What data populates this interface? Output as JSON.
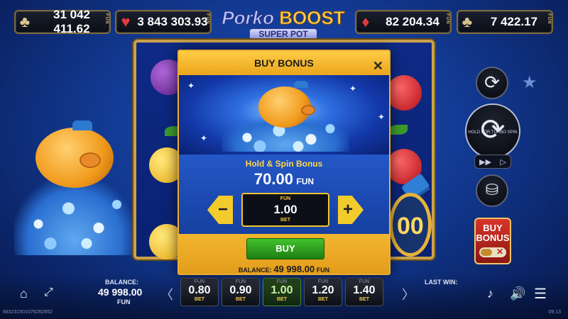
{
  "jackpots": [
    {
      "suit": "club-icon",
      "glyph": "♣",
      "value": "31 042 411.62",
      "unit": "FUN"
    },
    {
      "suit": "heart-icon",
      "glyph": "♥",
      "value": "3 843 303.93",
      "unit": "FUN"
    },
    {
      "suit": "diamond-icon",
      "glyph": "♦",
      "value": "82 204.34",
      "unit": "FUN"
    },
    {
      "suit": "club-icon",
      "glyph": "♣",
      "value": "7 422.17",
      "unit": "FUN"
    }
  ],
  "logo": {
    "part1": "Porko",
    "part2": "BOOST",
    "subtitle": "SUPER POT"
  },
  "modal": {
    "title": "BUY BONUS",
    "close_glyph": "✕",
    "bonus_name": "Hold & Spin Bonus",
    "price_value": "70.00",
    "price_currency": "FUN",
    "minus_glyph": "−",
    "plus_glyph": "+",
    "bet_top": "FUN",
    "bet_value": "1.00",
    "bet_bottom": "BET",
    "buy_label": "BUY",
    "balance_label": "BALANCE:",
    "balance_value": "49 998.00",
    "balance_currency": "FUN"
  },
  "reels": {
    "big_coin_text": "00"
  },
  "side": {
    "autoplay_glyph": "⟳",
    "star_glyph": "★",
    "spin_hold_text": "HOLD FOR TURBO SPIN",
    "spin_glyph": "⟳",
    "turbo_left": "▶▶",
    "turbo_right": "▷",
    "coins_glyph": "⛁",
    "buy_bonus_line1": "BUY",
    "buy_bonus_line2": "BONUS",
    "buy_bonus_toggle_x": "✕"
  },
  "bottom": {
    "home_glyph": "⌂",
    "fullscreen_glyph": "⤢",
    "balance_label": "BALANCE:",
    "balance_value": "49 998.00",
    "balance_unit": "FUN",
    "arrow_left": "〈",
    "arrow_right": "〉",
    "bets": [
      {
        "top": "FUN",
        "value": "0.80",
        "bottom": "BET",
        "selected": false
      },
      {
        "top": "FUN",
        "value": "0.90",
        "bottom": "BET",
        "selected": false
      },
      {
        "top": "FUN",
        "value": "1.00",
        "bottom": "BET",
        "selected": true
      },
      {
        "top": "FUN",
        "value": "1.20",
        "bottom": "BET",
        "selected": false
      },
      {
        "top": "FUN",
        "value": "1.40",
        "bottom": "BET",
        "selected": false
      }
    ],
    "last_win_label": "LAST WIN:",
    "music_glyph": "♪",
    "sound_glyph": "🔊",
    "menu_glyph": "☰",
    "session_id": "683231501076262652",
    "clock": "09:13"
  }
}
